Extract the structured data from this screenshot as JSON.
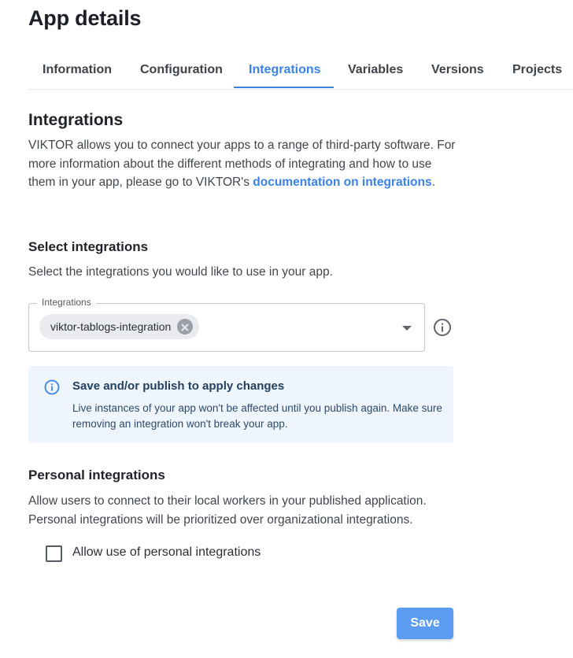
{
  "page": {
    "title": "App details"
  },
  "tabs": [
    {
      "label": "Information"
    },
    {
      "label": "Configuration"
    },
    {
      "label": "Integrations",
      "active": true
    },
    {
      "label": "Variables"
    },
    {
      "label": "Versions"
    },
    {
      "label": "Projects"
    }
  ],
  "integrations_section": {
    "heading": "Integrations",
    "intro_prefix": "VIKTOR allows you to connect your apps to a range of third-party software. For more information about the different methods of integrating and how to use them in your app, please go to VIKTOR's ",
    "intro_link": "documentation on integrations",
    "intro_suffix": "."
  },
  "select_integrations": {
    "heading": "Select integrations",
    "description": "Select the integrations you would like to use in your app.",
    "field_label": "Integrations",
    "selected_chips": [
      "viktor-tablogs-integration"
    ]
  },
  "alert": {
    "title": "Save and/or publish to apply changes",
    "body": "Live instances of your app won't be affected until you publish again. Make sure removing an integration won't break your app."
  },
  "personal_integrations": {
    "heading": "Personal integrations",
    "description_line1": "Allow users to connect to their local workers in your published application.",
    "description_line2": "Personal integrations will be prioritized over organizational integrations.",
    "checkbox_label": "Allow use of personal integrations",
    "checked": false
  },
  "actions": {
    "save_label": "Save"
  },
  "colors": {
    "accent": "#3b82e6",
    "save_button": "#5b9cf0",
    "alert_background": "#eef5fd"
  },
  "icons": {
    "chip_remove": "close-circle-icon",
    "dropdown": "arrow-drop-down-icon",
    "field_help": "info-outline-icon",
    "alert": "info-icon",
    "checkbox": "checkbox-unchecked-icon"
  }
}
